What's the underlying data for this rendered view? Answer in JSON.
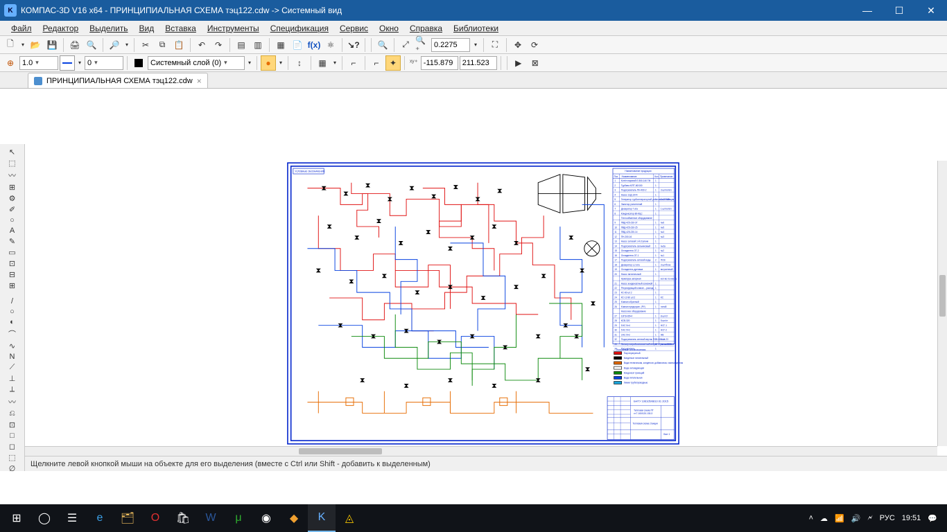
{
  "window": {
    "title": "КОМПАС-3D V16  x64 - ПРИНЦИПИАЛЬНАЯ СХЕМА тэц122.cdw -> Системный вид",
    "app_badge": "K"
  },
  "menubar": {
    "file": "Файл",
    "edit": "Редактор",
    "select": "Выделить",
    "view": "Вид",
    "insert": "Вставка",
    "tools": "Инструменты",
    "spec": "Спецификация",
    "service": "Сервис",
    "window": "Окно",
    "help": "Справка",
    "libs": "Библиотеки"
  },
  "toolbar1": {
    "zoom_value": "0.2275"
  },
  "toolbar2": {
    "scale_value": "1.0",
    "step_value": "0",
    "layer_label": "Системный слой (0)",
    "coord_x": "-115.879",
    "coord_y": "211.523"
  },
  "doc_tab": {
    "label": "ПРИНЦИПИАЛЬНАЯ СХЕМА тэц122.cdw",
    "close": "×"
  },
  "statusbar": {
    "hint": "Щелкните левой кнопкой мыши на объекте для его выделения (вместе с Ctrl или Shift - добавить к выделенным)"
  },
  "taskbar": {
    "lang": "РУС",
    "time": "19:51"
  },
  "icons": {
    "new": "🗋",
    "open": "📂",
    "save": "💾",
    "print": "🖨",
    "preview": "🔍",
    "cut": "✂",
    "copy": "⧉",
    "paste": "📋",
    "undo": "↶",
    "redo": "↷",
    "props": "⚙",
    "vars": "f(x)",
    "lib": "📚",
    "help": "?",
    "zoom_win": "🔍",
    "zoom_all": "⛶",
    "zoom_prev": "↩",
    "zoom_scale": "⤢",
    "pan": "✥",
    "refresh": "⟳",
    "local_cs": "⊕",
    "grid": "▦",
    "ortho": "⌐",
    "snap_end": "⌙",
    "snap_mid": "◇",
    "play": "▶",
    "pause": "⏸"
  },
  "left_tools": [
    "↖",
    "⬚",
    "〰",
    "⊞",
    "⚙",
    "✐",
    "○",
    "A",
    "✎",
    "▭",
    "⊡",
    "⊟",
    "⊞",
    "—",
    "/",
    "○",
    "◐",
    "⌒",
    "∿",
    "N",
    "⟋",
    "⊥",
    "⟂",
    "〰",
    "⎌",
    "⊡",
    "□",
    "◻",
    "⬚",
    "∅"
  ],
  "schematic": {
    "title_box": "УСЛОВНЫЕ ОБОЗНАЧЕНИЯ",
    "bom_title": "Наименование продукции",
    "bom_cols": [
      "Поз.",
      "Наименование",
      "Кол",
      "Примечание"
    ],
    "title_block": {
      "doc_no": "БНТУ 106105/0810 01 2015",
      "name1": "Тепловая схема ПТ",
      "name2": "ст.Т-100/120-130-3",
      "sheet": "Тепловая схема станции",
      "format": "Лист 1"
    },
    "legend_title": "Условные обозначения",
    "legend": [
      {
        "color": "#e01212",
        "label": "Пар перегретый"
      },
      {
        "color": "#000000",
        "label": "Конденсат питательный"
      },
      {
        "color": "#e66b00",
        "label": "Вода техническая, конденсат, добавочная, химочищенная"
      },
      {
        "color": "#ffffff",
        "stroke": "#000",
        "label": "Вода охлаждающая"
      },
      {
        "color": "#0d8a0d",
        "label": "Конденсат греющий"
      },
      {
        "color": "#0540e0",
        "label": "Вода питательная"
      },
      {
        "color": "#1aa3d9",
        "label": "Линии трубопроводные"
      }
    ],
    "bom_rows": [
      {
        "n": "1",
        "name": "Котёл паровой Е-500-140 ГМ",
        "q": "1",
        "note": ""
      },
      {
        "n": "2",
        "name": "Турбина К/ПТ-80/100",
        "q": "1",
        "note": ""
      },
      {
        "n": "3",
        "name": "Подогреватель ПН-400-2",
        "q": "1",
        "note": "3 шт/котёл"
      },
      {
        "n": "4",
        "name": "Насос 12Д-19×4",
        "q": "1",
        "note": ""
      },
      {
        "n": "5",
        "name": "Генератор турбогенераторной установки 63 МВт",
        "q": "1",
        "note": "3 шт/станция"
      },
      {
        "n": "6",
        "name": "Эжектор уплотнений",
        "q": "1",
        "note": ""
      },
      {
        "n": "7",
        "name": "Деаэратор 7 ата",
        "q": "1",
        "note": "1 шт/котёл"
      },
      {
        "n": "8",
        "name": "Конденсатор 80-КЦС",
        "q": "1",
        "note": ""
      },
      {
        "n": "",
        "name": "Теплообменное оборудование",
        "q": "",
        "note": ""
      },
      {
        "n": "9",
        "name": "ПВД-425-230-37",
        "q": "1",
        "note": "№6"
      },
      {
        "n": "10",
        "name": "ПВД-425-230-25",
        "q": "1",
        "note": "№5"
      },
      {
        "n": "11",
        "name": "ПВД-425-230-14",
        "q": "1",
        "note": "№4"
      },
      {
        "n": "12",
        "name": "ПН-200-16",
        "q": "1",
        "note": "№3"
      },
      {
        "n": "13",
        "name": "Насос сетевой 1-й ступени",
        "q": "1",
        "note": ""
      },
      {
        "n": "14",
        "name": "Подогреватель сальниковый",
        "q": "1",
        "note": "№3а"
      },
      {
        "n": "15",
        "name": "Охладитель ОГ-2",
        "q": "1",
        "note": "№2"
      },
      {
        "n": "16",
        "name": "Охладитель ОГ-1",
        "q": "1",
        "note": "№1"
      },
      {
        "n": "17",
        "name": "Подогреватель сетевой воды",
        "q": "2",
        "note": "ПСВ"
      },
      {
        "n": "18",
        "name": "Деаэратор 1,2 ата",
        "q": "1",
        "note": "3 шт/блок"
      },
      {
        "n": "19",
        "name": "Охладитель дренажа",
        "q": "1",
        "note": "встроенный"
      },
      {
        "n": "20",
        "name": "Насос питательный",
        "q": "1",
        "note": ""
      },
      {
        "n": "",
        "name": "Арматура запорная",
        "q": "",
        "note": "кол-во по месту"
      },
      {
        "n": "21",
        "name": "Насос конденсатный основной",
        "q": "1",
        "note": ""
      },
      {
        "n": "22",
        "name": "Регулирующий клапан – расход",
        "q": "1",
        "note": ""
      },
      {
        "n": "23",
        "name": "КС-80 шт.2",
        "q": "1",
        "note": ""
      },
      {
        "n": "24",
        "name": "КС-12-80 шт.2",
        "q": "1",
        "note": "КС"
      },
      {
        "n": "25",
        "name": "Клапан обратный",
        "q": "1",
        "note": ""
      },
      {
        "n": "26",
        "name": "Клапан предохран. (РУ)",
        "q": "1",
        "note": "литой"
      },
      {
        "n": "",
        "name": "Насосное оборудование",
        "q": "",
        "note": ""
      },
      {
        "n": "27",
        "name": "10ПЭ-65×4",
        "q": "1",
        "note": "8 шт/ст"
      },
      {
        "n": "28",
        "name": "КСВ-320",
        "q": "1",
        "note": "5 шт/ст"
      },
      {
        "n": "29",
        "name": "5 КС 5×4",
        "q": "1",
        "note": "НСГ-1"
      },
      {
        "n": "30",
        "name": "5 КС 5×2",
        "q": "1",
        "note": "НСГ-2"
      },
      {
        "n": "31",
        "name": "3 КС 5×2",
        "q": "1",
        "note": "НВ"
      },
      {
        "n": "32",
        "name": "Подогреватель сетевой вертик ПСВ-500-14-23",
        "q": "1",
        "note": "4 шт"
      },
      {
        "n": "33",
        "name": "Фильтр натрий-катионитный второй ступени 1500",
        "q": "1",
        "note": "по хим.схеме"
      },
      {
        "n": "34",
        "name": "Расширитель",
        "q": "1",
        "note": ""
      }
    ]
  }
}
